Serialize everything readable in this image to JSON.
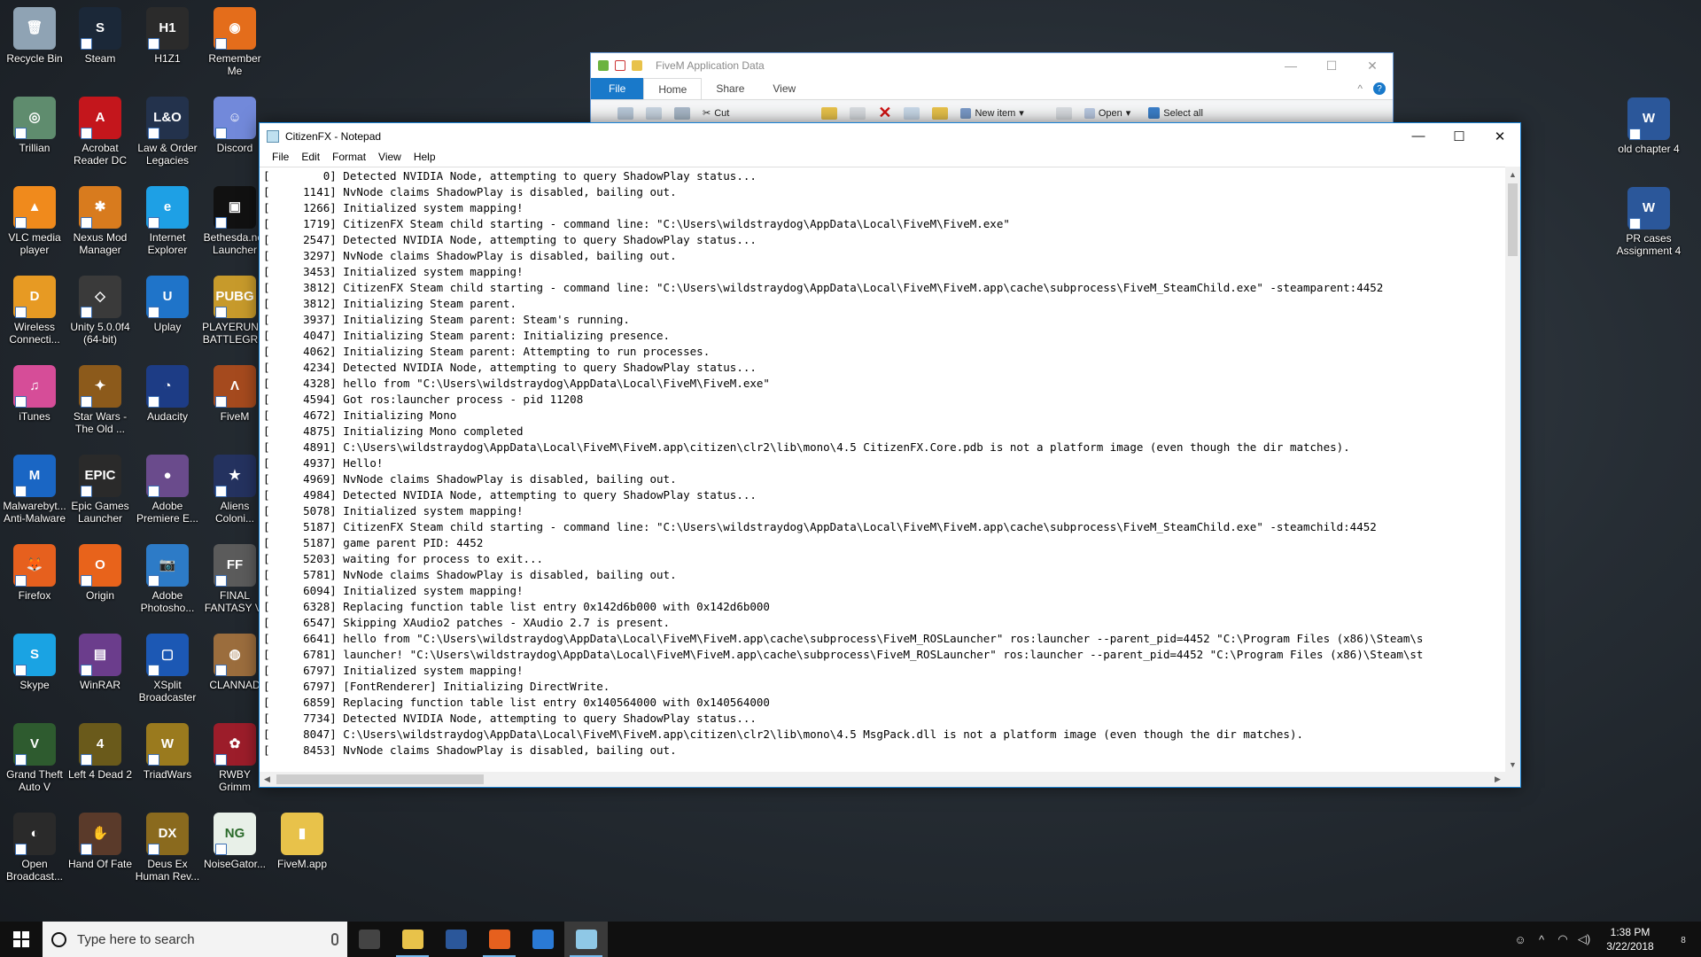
{
  "desktop_icons": [
    {
      "id": "recycle-bin",
      "label": "Recycle Bin",
      "glyph": "🗑",
      "color": "#8fa3b4",
      "noarrow": true
    },
    {
      "id": "steam",
      "label": "Steam",
      "glyph": "S",
      "color": "#1b2838"
    },
    {
      "id": "h1z1",
      "label": "H1Z1",
      "glyph": "H1",
      "color": "#2b2b2b"
    },
    {
      "id": "remember-me",
      "label": "Remember Me",
      "glyph": "◉",
      "color": "#e46d1b"
    },
    {
      "id": "trillian",
      "label": "Trillian",
      "glyph": "◎",
      "color": "#5f8c6e"
    },
    {
      "id": "acrobat",
      "label": "Acrobat Reader DC",
      "glyph": "A",
      "color": "#c4161c"
    },
    {
      "id": "law-order",
      "label": "Law & Order Legacies",
      "glyph": "L&O",
      "color": "#23324c"
    },
    {
      "id": "discord",
      "label": "Discord",
      "glyph": "☺",
      "color": "#7289da"
    },
    {
      "id": "vlc",
      "label": "VLC media player",
      "glyph": "▲",
      "color": "#f08a1c"
    },
    {
      "id": "nexus",
      "label": "Nexus Mod Manager",
      "glyph": "✱",
      "color": "#d87b1e"
    },
    {
      "id": "ie",
      "label": "Internet Explorer",
      "glyph": "e",
      "color": "#1ea0e5"
    },
    {
      "id": "bethesda",
      "label": "Bethesda.net Launcher",
      "glyph": "▣",
      "color": "#111111"
    },
    {
      "id": "dlink",
      "label": "Wireless Connecti...",
      "glyph": "D",
      "color": "#e79a23"
    },
    {
      "id": "unity",
      "label": "Unity 5.0.0f4 (64-bit)",
      "glyph": "◇",
      "color": "#3a3a3a"
    },
    {
      "id": "uplay",
      "label": "Uplay",
      "glyph": "U",
      "color": "#1f74c9"
    },
    {
      "id": "pubg",
      "label": "PLAYERUN... BATTLEGR...",
      "glyph": "PUBG",
      "color": "#c79a2b"
    },
    {
      "id": "itunes",
      "label": "iTunes",
      "glyph": "♫",
      "color": "#d64d98"
    },
    {
      "id": "swtor",
      "label": "Star Wars - The Old ...",
      "glyph": "✦",
      "color": "#8c5a1b"
    },
    {
      "id": "audacity",
      "label": "Audacity",
      "glyph": "◔",
      "color": "#1d3c85"
    },
    {
      "id": "fivem",
      "label": "FiveM",
      "glyph": "Λ",
      "color": "#a54a1e"
    },
    {
      "id": "malwarebytes",
      "label": "Malwarebyt... Anti-Malware",
      "glyph": "M",
      "color": "#1a66c4"
    },
    {
      "id": "epic",
      "label": "Epic Games Launcher",
      "glyph": "EPIC",
      "color": "#2a2a2a"
    },
    {
      "id": "premiere",
      "label": "Adobe Premiere E...",
      "glyph": "●",
      "color": "#6a4b8c"
    },
    {
      "id": "aliens",
      "label": "Aliens Coloni...",
      "glyph": "★",
      "color": "#24325f"
    },
    {
      "id": "firefox",
      "label": "Firefox",
      "glyph": "🦊",
      "color": "#e6601e"
    },
    {
      "id": "origin",
      "label": "Origin",
      "glyph": "O",
      "color": "#e8631b"
    },
    {
      "id": "photoshop",
      "label": "Adobe Photosho...",
      "glyph": "📷",
      "color": "#2d7bc7"
    },
    {
      "id": "ffvi",
      "label": "FINAL FANTASY VI",
      "glyph": "FF",
      "color": "#5b5b5b"
    },
    {
      "id": "skype",
      "label": "Skype",
      "glyph": "S",
      "color": "#1aa3e3"
    },
    {
      "id": "winrar",
      "label": "WinRAR",
      "glyph": "▤",
      "color": "#6b3d8c"
    },
    {
      "id": "xsplit",
      "label": "XSplit Broadcaster",
      "glyph": "▢",
      "color": "#1c58b4"
    },
    {
      "id": "clannad",
      "label": "CLANNAD",
      "glyph": "◍",
      "color": "#9b6d3d"
    },
    {
      "id": "gta5",
      "label": "Grand Theft Auto V",
      "glyph": "V",
      "color": "#2e5b2f"
    },
    {
      "id": "l4d2",
      "label": "Left 4 Dead 2",
      "glyph": "4",
      "color": "#6a5a1b"
    },
    {
      "id": "triadwars",
      "label": "TriadWars",
      "glyph": "W",
      "color": "#9a7a1e"
    },
    {
      "id": "rwby",
      "label": "RWBY Grimm Eclipse",
      "glyph": "✿",
      "color": "#9c1d2a"
    },
    {
      "id": "obs",
      "label": "Open Broadcast...",
      "glyph": "◐",
      "color": "#2a2a2a"
    },
    {
      "id": "handoffate",
      "label": "Hand Of Fate",
      "glyph": "✋",
      "color": "#5a3a2a"
    },
    {
      "id": "deusex",
      "label": "Deus Ex Human Rev...",
      "glyph": "DX",
      "color": "#8a6a1e"
    },
    {
      "id": "noisegator",
      "label": "NoiseGator...",
      "glyph": "NG",
      "color": "#e8f0e8"
    },
    {
      "id": "fivem-app",
      "label": "FiveM.app",
      "glyph": "▮",
      "color": "#e8c24a",
      "noarrow": true
    },
    {
      "id": "old-chapter-4",
      "label": "old chapter 4",
      "glyph": "W",
      "color": "#2b579a"
    },
    {
      "id": "pr-cases",
      "label": "PR cases Assignment 4",
      "glyph": "W",
      "color": "#2b579a"
    }
  ],
  "explorer": {
    "title": "FiveM Application Data",
    "tabs": [
      "File",
      "Home",
      "Share",
      "View"
    ],
    "ribbon": [
      "Cut",
      "New item",
      "Open",
      "Select all"
    ],
    "controls": [
      "—",
      "☐",
      "✕"
    ]
  },
  "notepad": {
    "title": "CitizenFX - Notepad",
    "menu": [
      "File",
      "Edit",
      "Format",
      "View",
      "Help"
    ],
    "controls": [
      "—",
      "☐",
      "✕"
    ],
    "lines": [
      "[        0] Detected NVIDIA Node, attempting to query ShadowPlay status...",
      "[     1141] NvNode claims ShadowPlay is disabled, bailing out.",
      "[     1266] Initialized system mapping!",
      "[     1719] CitizenFX Steam child starting - command line: \"C:\\Users\\wildstraydog\\AppData\\Local\\FiveM\\FiveM.exe\"",
      "[     2547] Detected NVIDIA Node, attempting to query ShadowPlay status...",
      "[     3297] NvNode claims ShadowPlay is disabled, bailing out.",
      "[     3453] Initialized system mapping!",
      "[     3812] CitizenFX Steam child starting - command line: \"C:\\Users\\wildstraydog\\AppData\\Local\\FiveM\\FiveM.app\\cache\\subprocess\\FiveM_SteamChild.exe\" -steamparent:4452",
      "[     3812] Initializing Steam parent.",
      "[     3937] Initializing Steam parent: Steam's running.",
      "[     4047] Initializing Steam parent: Initializing presence.",
      "[     4062] Initializing Steam parent: Attempting to run processes.",
      "[     4234] Detected NVIDIA Node, attempting to query ShadowPlay status...",
      "[     4328] hello from \"C:\\Users\\wildstraydog\\AppData\\Local\\FiveM\\FiveM.exe\"",
      "[     4594] Got ros:launcher process - pid 11208",
      "[     4672] Initializing Mono",
      "[     4875] Initializing Mono completed",
      "[     4891] C:\\Users\\wildstraydog\\AppData\\Local\\FiveM\\FiveM.app\\citizen\\clr2\\lib\\mono\\4.5 CitizenFX.Core.pdb is not a platform image (even though the dir matches).",
      "[     4937] Hello!",
      "[     4969] NvNode claims ShadowPlay is disabled, bailing out.",
      "[     4984] Detected NVIDIA Node, attempting to query ShadowPlay status...",
      "[     5078] Initialized system mapping!",
      "[     5187] CitizenFX Steam child starting - command line: \"C:\\Users\\wildstraydog\\AppData\\Local\\FiveM\\FiveM.app\\cache\\subprocess\\FiveM_SteamChild.exe\" -steamchild:4452",
      "[     5187] game parent PID: 4452",
      "[     5203] waiting for process to exit...",
      "[     5781] NvNode claims ShadowPlay is disabled, bailing out.",
      "[     6094] Initialized system mapping!",
      "[     6328] Replacing function table list entry 0x142d6b000 with 0x142d6b000",
      "[     6547] Skipping XAudio2 patches - XAudio 2.7 is present.",
      "[     6641] hello from \"C:\\Users\\wildstraydog\\AppData\\Local\\FiveM\\FiveM.app\\cache\\subprocess\\FiveM_ROSLauncher\" ros:launcher --parent_pid=4452 \"C:\\Program Files (x86)\\Steam\\s",
      "[     6781] launcher! \"C:\\Users\\wildstraydog\\AppData\\Local\\FiveM\\FiveM.app\\cache\\subprocess\\FiveM_ROSLauncher\" ros:launcher --parent_pid=4452 \"C:\\Program Files (x86)\\Steam\\st",
      "[     6797] Initialized system mapping!",
      "[     6797] [FontRenderer] Initializing DirectWrite.",
      "[     6859] Replacing function table list entry 0x140564000 with 0x140564000",
      "[     7734] Detected NVIDIA Node, attempting to query ShadowPlay status...",
      "[     8047] C:\\Users\\wildstraydog\\AppData\\Local\\FiveM\\FiveM.app\\citizen\\clr2\\lib\\mono\\4.5 MsgPack.dll is not a platform image (even though the dir matches).",
      "[     8453] NvNode claims ShadowPlay is disabled, bailing out."
    ]
  },
  "taskbar": {
    "search_placeholder": "Type here to search",
    "apps": [
      {
        "id": "task-view",
        "color": "#444444"
      },
      {
        "id": "file-explorer",
        "color": "#e8c24a",
        "open": true
      },
      {
        "id": "word",
        "color": "#2b579a"
      },
      {
        "id": "firefox",
        "color": "#e6601e",
        "open": true
      },
      {
        "id": "store",
        "color": "#2a7ad5"
      },
      {
        "id": "notepad",
        "color": "#8fc8e6",
        "open": true,
        "active": true
      }
    ],
    "time": "1:38 PM",
    "date": "3/22/2018",
    "notification_count": "8"
  }
}
